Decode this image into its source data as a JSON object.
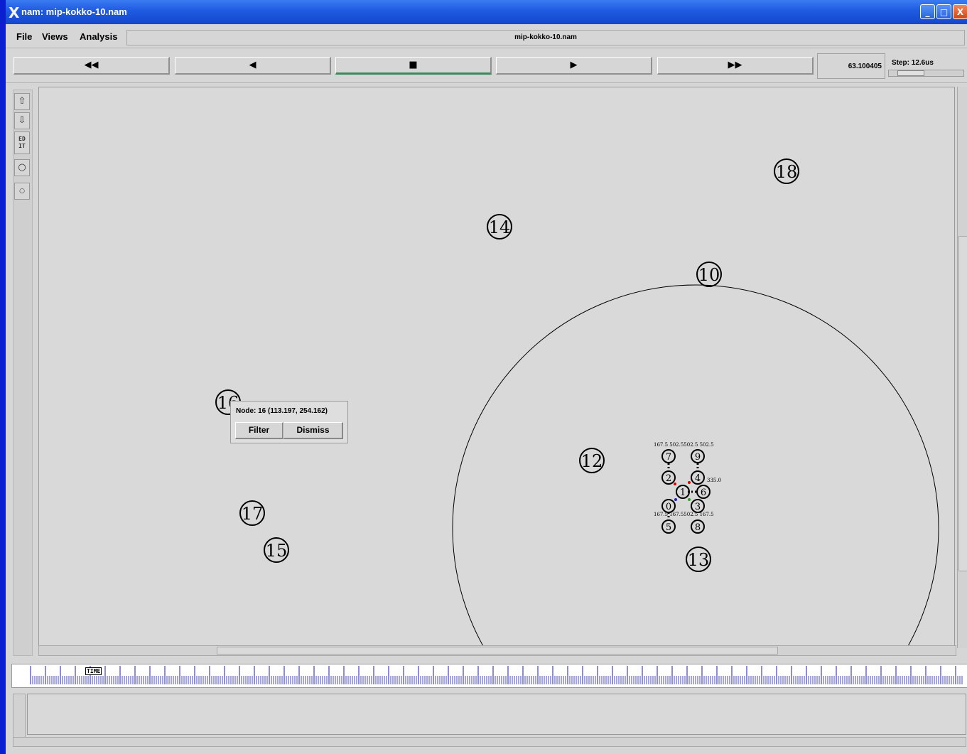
{
  "window": {
    "title": "nam: mip-kokko-10.nam",
    "controls": {
      "minimize": "_",
      "maximize": "□",
      "close": "X"
    }
  },
  "menu": {
    "file": "File",
    "views": "Views",
    "analysis": "Analysis",
    "filename": "mip-kokko-10.nam"
  },
  "toolbar": {
    "rewind": "◀◀",
    "back": "◀",
    "stop": "■",
    "play": "▶",
    "fast_forward": "▶▶",
    "time": "63.100405",
    "step": "Step: 12.6us"
  },
  "sidebar": {
    "zoom_in": "⇧",
    "zoom_out": "⇩",
    "edit": "ED IT",
    "node_large": "○",
    "node_small": "○"
  },
  "nodes": {
    "n0": "0",
    "n1": "1",
    "n2": "2",
    "n3": "3",
    "n4": "4",
    "n5": "5",
    "n6": "6",
    "n7": "7",
    "n8": "8",
    "n9": "9",
    "n10": "10",
    "n12": "12",
    "n13": "13",
    "n14": "14",
    "n15": "15",
    "n16": "16",
    "n17": "17",
    "n18": "18"
  },
  "annotations": {
    "top_label": "167.5 502.5502.5 502.5",
    "right_label": "335.0",
    "bottom_label": "167.5 167.5502.5 167.5"
  },
  "popup": {
    "title": "Node: 16 (113.197, 254.162)",
    "filter": "Filter",
    "dismiss": "Dismiss"
  },
  "timeline": {
    "label": "TIME"
  }
}
